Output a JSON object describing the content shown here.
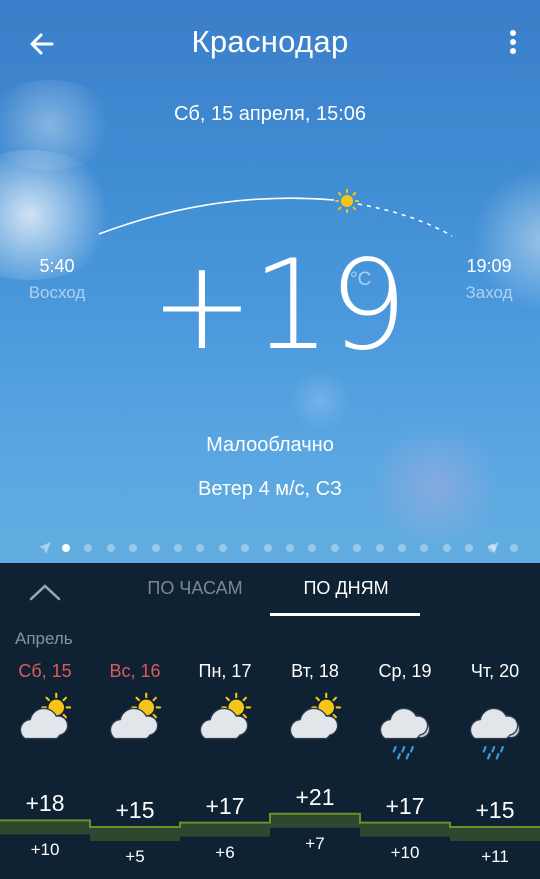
{
  "header": {
    "city": "Краснодар",
    "back_icon": "arrow-left-icon",
    "menu_icon": "more-vertical-icon"
  },
  "current": {
    "datetime": "Сб, 15 апреля, 15:06",
    "sunrise_time": "5:40",
    "sunrise_label": "Восход",
    "sunset_time": "19:09",
    "sunset_label": "Заход",
    "temperature": "+19",
    "unit": "°C",
    "condition": "Малооблачно",
    "wind": "Ветер 4 м/с, СЗ",
    "pages_total": 21,
    "page_active": 1
  },
  "tabs": {
    "hours": "ПО ЧАСАМ",
    "days": "ПО ДНЯМ",
    "active": "days"
  },
  "forecast": {
    "month": "Апрель",
    "days": [
      {
        "label": "Сб, 15",
        "weekend": true,
        "icon": "partly-cloudy-icon",
        "max": "+18",
        "min": "+10",
        "max_value": 18,
        "min_value": 10
      },
      {
        "label": "Вс, 16",
        "weekend": true,
        "icon": "partly-cloudy-icon",
        "max": "+15",
        "min": "+5",
        "max_value": 15,
        "min_value": 5
      },
      {
        "label": "Пн, 17",
        "weekend": false,
        "icon": "partly-cloudy-icon",
        "max": "+17",
        "min": "+6",
        "max_value": 17,
        "min_value": 6
      },
      {
        "label": "Вт, 18",
        "weekend": false,
        "icon": "partly-cloudy-icon",
        "max": "+21",
        "min": "+7",
        "max_value": 21,
        "min_value": 7
      },
      {
        "label": "Ср, 19",
        "weekend": false,
        "icon": "rain-icon",
        "max": "+17",
        "min": "+10",
        "max_value": 17,
        "min_value": 10
      },
      {
        "label": "Чт, 20",
        "weekend": false,
        "icon": "rain-icon",
        "max": "+15",
        "min": "+11",
        "max_value": 15,
        "min_value": 11
      }
    ]
  },
  "colors": {
    "weekend": "#e05a5a",
    "graph": "#6b8f2a",
    "panel": "#0f2233",
    "sun": "#f5c518"
  }
}
